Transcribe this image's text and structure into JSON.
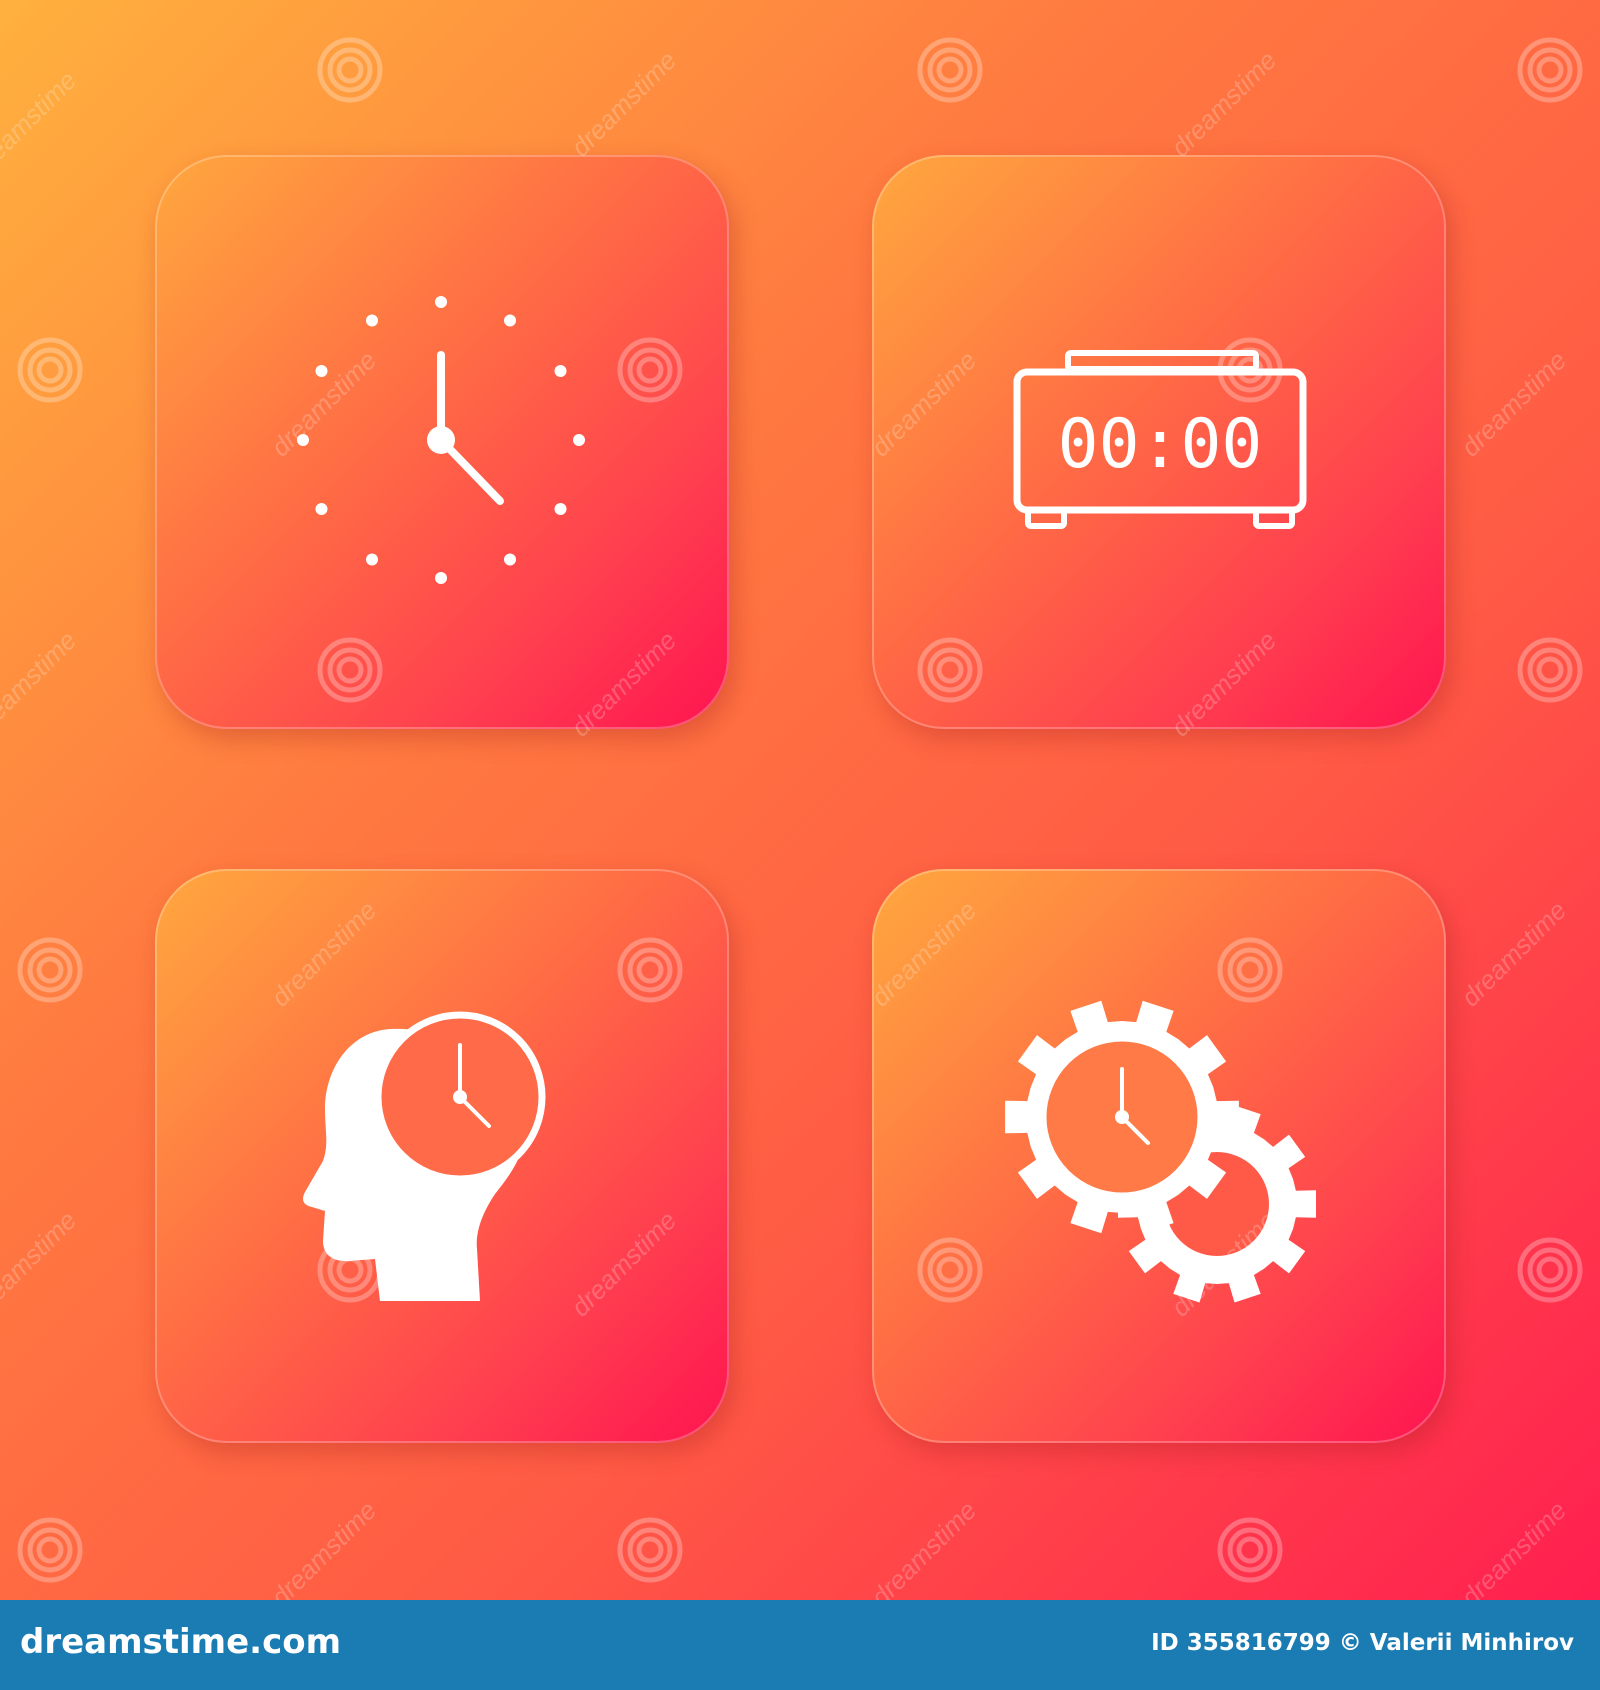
{
  "icons": [
    {
      "name": "wall-clock",
      "label": ""
    },
    {
      "name": "digital-alarm-clock",
      "display": "00:00"
    },
    {
      "name": "human-head-with-clock",
      "label": ""
    },
    {
      "name": "gear-with-clock",
      "label": ""
    }
  ],
  "colors": {
    "background_start": "#ffb13e",
    "background_end": "#ff1f50",
    "icon": "#ffffff",
    "footer_bar": "#1b7cb3"
  },
  "watermark": {
    "text": "dreamstime",
    "icon": "dreamstime-spiral-icon"
  },
  "footer": {
    "site": "dreamstime.com",
    "credit": "ID 355816799 © Valerii Minhirov"
  }
}
